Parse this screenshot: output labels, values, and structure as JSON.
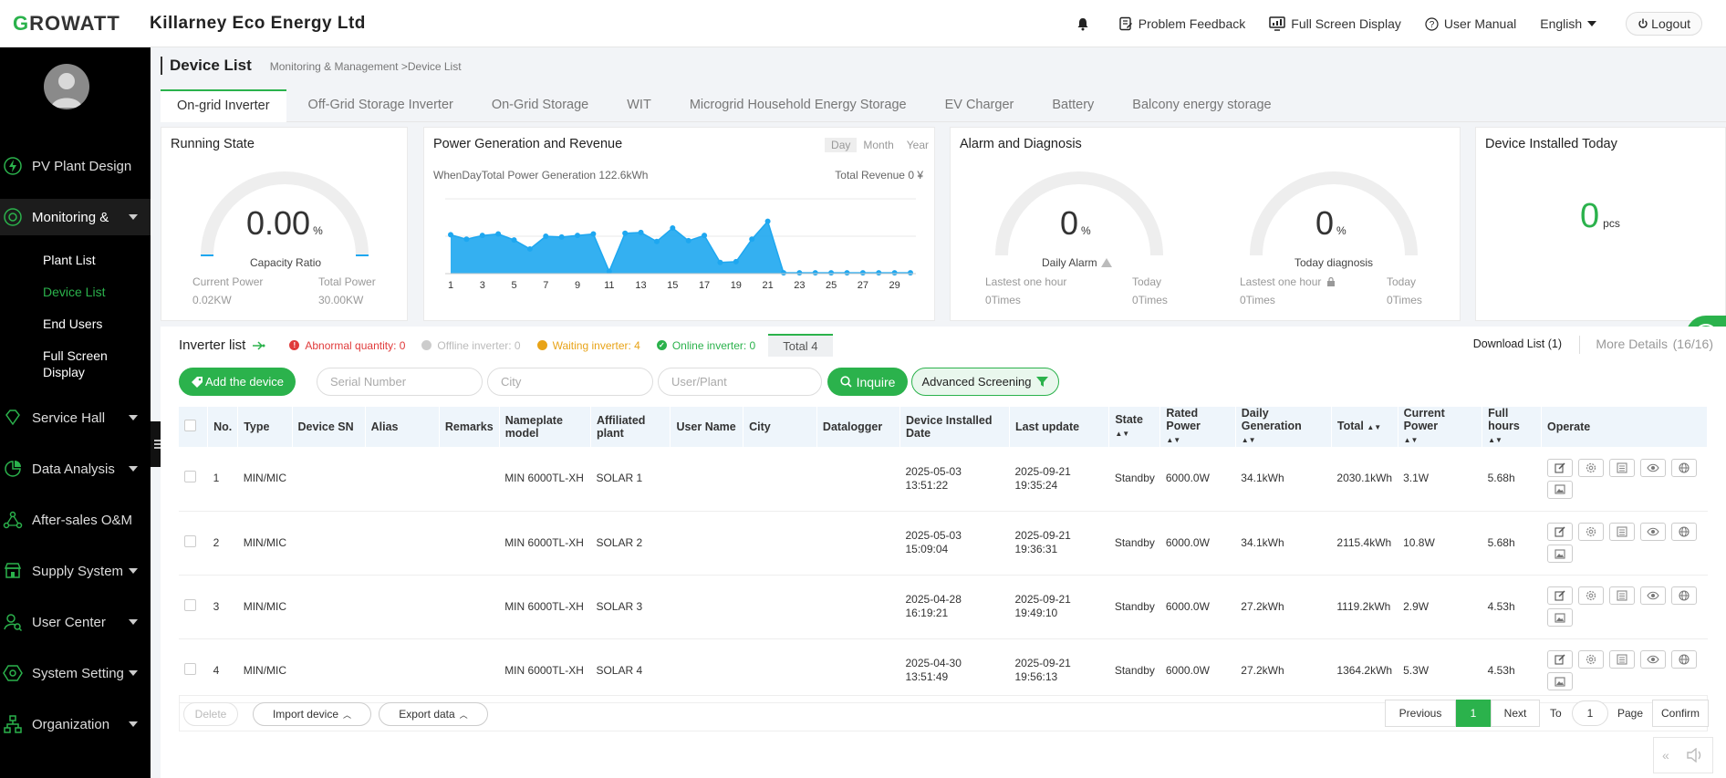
{
  "header": {
    "logo_first": "G",
    "logo_rest": "ROWATT",
    "company": "Killarney Eco Energy Ltd",
    "problem_feedback": "Problem Feedback",
    "full_screen": "Full Screen Display",
    "user_manual": "User Manual",
    "language": "English",
    "logout": "Logout"
  },
  "sidebar": {
    "items": [
      {
        "label": "PV Plant Design",
        "icon": "lightning-icon"
      },
      {
        "label": "Monitoring &",
        "icon": "monitor-icon"
      },
      {
        "label": "Service Hall",
        "icon": "diamond-icon"
      },
      {
        "label": "Data Analysis",
        "icon": "analysis-icon"
      },
      {
        "label": "After-sales O&M",
        "icon": "network-icon"
      },
      {
        "label": "Supply System",
        "icon": "store-icon"
      },
      {
        "label": "User Center",
        "icon": "user-search-icon"
      },
      {
        "label": "System Setting",
        "icon": "hexagon-icon"
      },
      {
        "label": "Organization",
        "icon": "org-icon"
      }
    ],
    "sub_items": [
      "Plant List",
      "Device List",
      "End Users",
      "Full Screen",
      "Display"
    ]
  },
  "page": {
    "title": "Device List",
    "breadcrumb": "Monitoring & Management >Device List"
  },
  "tabs": [
    "On-grid Inverter",
    "Off-Grid Storage Inverter",
    "On-Grid Storage",
    "WIT",
    "Microgrid Household Energy Storage",
    "EV Charger",
    "Battery",
    "Balcony energy storage"
  ],
  "running_state": {
    "title": "Running State",
    "value": "0.00",
    "unit": "%",
    "caption": "Capacity Ratio",
    "current_power_label": "Current Power",
    "current_power": "0.02KW",
    "total_power_label": "Total Power",
    "total_power": "30.00KW",
    "gauge_fraction": 0
  },
  "power_gen": {
    "title": "Power Generation and Revenue",
    "periods": [
      "Day",
      "Month",
      "Year"
    ],
    "summary": "WhenDayTotal Power Generation 122.6kWh",
    "revenue": "Total Revenue 0 ¥"
  },
  "chart_data": {
    "type": "area",
    "x": [
      1,
      2,
      3,
      4,
      5,
      6,
      7,
      8,
      9,
      10,
      11,
      12,
      13,
      14,
      15,
      16,
      17,
      18,
      19,
      20,
      21,
      22,
      23,
      24,
      25,
      26,
      27,
      28,
      29,
      30
    ],
    "xticks": [
      "1",
      "3",
      "5",
      "7",
      "9",
      "11",
      "13",
      "15",
      "17",
      "19",
      "21",
      "23",
      "25",
      "27",
      "29"
    ],
    "values": [
      5.2,
      4.6,
      5.1,
      5.3,
      4.5,
      3.3,
      5.0,
      4.9,
      5.1,
      5.3,
      0.3,
      5.4,
      5.5,
      4.3,
      6.1,
      4.4,
      5.1,
      1.5,
      1.6,
      4.6,
      7.0,
      0.1,
      0.1,
      0.1,
      0.1,
      0.1,
      0.1,
      0.1,
      0.1,
      0.1
    ],
    "ylim": [
      0,
      10
    ],
    "grid": true,
    "color": "#1ea7f0"
  },
  "alarm": {
    "title": "Alarm and Diagnosis",
    "alarm_value": "0",
    "alarm_unit": "%",
    "alarm_caption": "Daily Alarm",
    "diag_value": "0",
    "diag_unit": "%",
    "diag_caption": "Today diagnosis",
    "lastest_label": "Lastest one hour",
    "today_label": "Today",
    "times": "0Times"
  },
  "installed": {
    "title": "Device Installed Today",
    "value": "0",
    "unit": "pcs"
  },
  "inverter_list": {
    "title": "Inverter list",
    "abnormal": "Abnormal quantity: 0",
    "offline": "Offline inverter: 0",
    "waiting": "Waiting inverter: 4",
    "online": "Online inverter: 0",
    "total": "Total 4",
    "download": "Download List (1)",
    "more": "More Details",
    "more_count": "(16/16)"
  },
  "toolbar": {
    "add_device": "Add the device",
    "serial_placeholder": "Serial Number",
    "city_placeholder": "City",
    "user_placeholder": "User/Plant",
    "inquire": "Inquire",
    "advanced": "Advanced Screening"
  },
  "table": {
    "headers": [
      "No.",
      "Type",
      "Device SN",
      "Alias",
      "Remarks",
      "Nameplate model",
      "Affiliated plant",
      "User Name",
      "City",
      "Datalogger",
      "Device Installed Date",
      "Last update",
      "State",
      "Rated Power",
      "Daily Generation",
      "Total",
      "Current Power",
      "Full hours",
      "Operate"
    ],
    "rows": [
      {
        "no": "1",
        "type": "MIN/MIC",
        "model": "MIN 6000TL-XH",
        "plant": "SOLAR 1",
        "installed": "2025-05-03 13:51:22",
        "update_date": "2025-09-21",
        "update_time": "19:35:24",
        "state": "Standby",
        "rated": "6000.0W",
        "daily": "34.1kWh",
        "total": "2030.1kWh",
        "current": "3.1W",
        "hours": "5.68h"
      },
      {
        "no": "2",
        "type": "MIN/MIC",
        "model": "MIN 6000TL-XH",
        "plant": "SOLAR 2",
        "installed": "2025-05-03 15:09:04",
        "update_date": "2025-09-21",
        "update_time": "19:36:31",
        "state": "Standby",
        "rated": "6000.0W",
        "daily": "34.1kWh",
        "total": "2115.4kWh",
        "current": "10.8W",
        "hours": "5.68h"
      },
      {
        "no": "3",
        "type": "MIN/MIC",
        "model": "MIN 6000TL-XH",
        "plant": "SOLAR 3",
        "installed": "2025-04-28 16:19:21",
        "update_date": "2025-09-21",
        "update_time": "19:49:10",
        "state": "Standby",
        "rated": "6000.0W",
        "daily": "27.2kWh",
        "total": "1119.2kWh",
        "current": "2.9W",
        "hours": "4.53h"
      },
      {
        "no": "4",
        "type": "MIN/MIC",
        "model": "MIN 6000TL-XH",
        "plant": "SOLAR 4",
        "installed": "2025-04-30 13:51:49",
        "update_date": "2025-09-21",
        "update_time": "19:56:13",
        "state": "Standby",
        "rated": "6000.0W",
        "daily": "27.2kWh",
        "total": "1364.2kWh",
        "current": "5.3W",
        "hours": "4.53h"
      }
    ]
  },
  "footer": {
    "delete": "Delete",
    "import": "Import device",
    "export": "Export data",
    "previous": "Previous",
    "page": "1",
    "next": "Next",
    "to": "To",
    "goto_page": "1",
    "page_label": "Page",
    "confirm": "Confirm"
  }
}
